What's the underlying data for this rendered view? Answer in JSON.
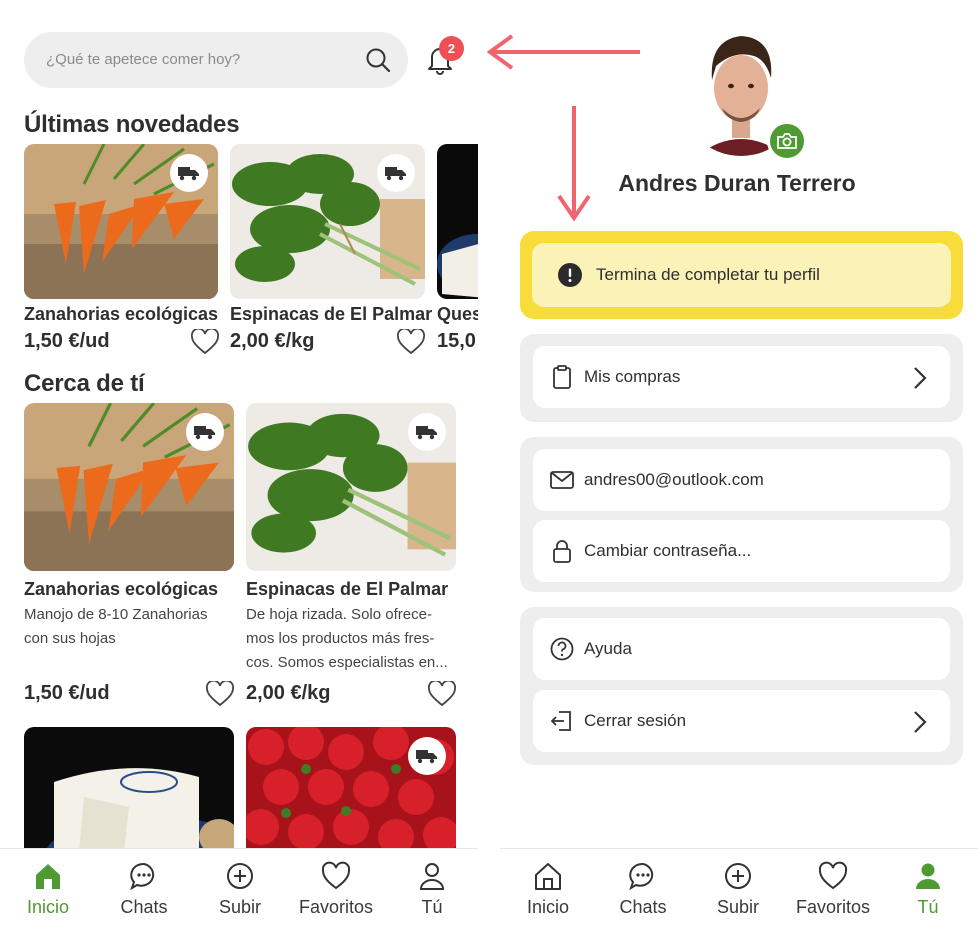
{
  "left_screen": {
    "search": {
      "placeholder": "¿Qué te apetece comer hoy?"
    },
    "notifications": {
      "count": "2",
      "icon": "bell-icon"
    },
    "latest": {
      "title": "Últimas novedades",
      "items": [
        {
          "name": "Zanahorias ecológicas",
          "price": "1,50 €/ud"
        },
        {
          "name": "Espinacas de El Palmar",
          "price": "2,00 €/kg"
        },
        {
          "name": "Ques",
          "price": "15,0"
        }
      ]
    },
    "nearby": {
      "title": "Cerca de tí",
      "items": [
        {
          "name": "Zanahorias ecológicas",
          "desc_lines": [
            "Manojo de 8-10 Zanahorias",
            "con sus hojas"
          ],
          "price": "1,50 €/ud"
        },
        {
          "name": "Espinacas de El Palmar",
          "desc_lines": [
            "De hoja rizada. Solo ofrece-",
            "mos los productos más fres-",
            "cos. Somos especialistas en..."
          ],
          "price": "2,00 €/kg"
        }
      ]
    },
    "tabs": [
      {
        "label": "Inicio",
        "icon": "home-icon",
        "active": true
      },
      {
        "label": "Chats",
        "icon": "chat-icon",
        "active": false
      },
      {
        "label": "Subir",
        "icon": "plus-circle-icon",
        "active": false
      },
      {
        "label": "Favoritos",
        "icon": "heart-icon",
        "active": false
      },
      {
        "label": "Tú",
        "icon": "user-icon",
        "active": false
      }
    ]
  },
  "right_screen": {
    "user_name": "Andres Duran Terrero",
    "profile_warning": "Termina de completar tu perfil",
    "menu": {
      "purchases": "Mis compras",
      "email": "andres00@outlook.com",
      "change_password": "Cambiar contraseña...",
      "help": "Ayuda",
      "logout": "Cerrar sesión"
    },
    "tabs": [
      {
        "label": "Inicio",
        "icon": "home-icon",
        "active": false
      },
      {
        "label": "Chats",
        "icon": "chat-icon",
        "active": false
      },
      {
        "label": "Subir",
        "icon": "plus-circle-icon",
        "active": false
      },
      {
        "label": "Favoritos",
        "icon": "heart-icon",
        "active": false
      },
      {
        "label": "Tú",
        "icon": "user-icon",
        "active": true
      }
    ]
  },
  "colors": {
    "accent_green": "#4e9a33",
    "badge_red": "#ef4e55",
    "arrow_red": "#f06470",
    "warning_yellow": "#f8dd3a",
    "warning_fill": "#fbf2b8"
  }
}
